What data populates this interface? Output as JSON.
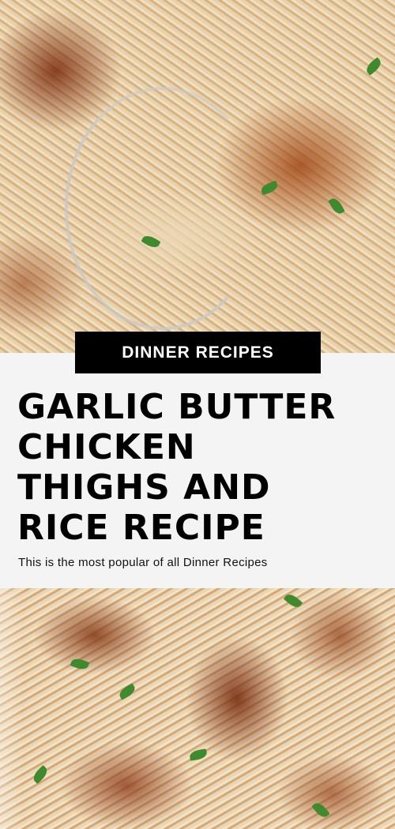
{
  "photos": {
    "top": "garlic butter chicken thighs with rice and spoon",
    "bottom": "garlic butter chicken thighs over rice in skillet"
  },
  "tag": {
    "label": "DINNER RECIPES"
  },
  "title": {
    "lines": [
      "GARLIC BUTTER",
      "CHICKEN",
      "THIGHS AND",
      "RICE RECIPE"
    ]
  },
  "subtitle": "This is the most popular of all Dinner Recipes",
  "colors": {
    "tag_bg": "#000000",
    "tag_text": "#ffffff",
    "panel_bg": "#f4f4f4",
    "title": "#000000"
  }
}
